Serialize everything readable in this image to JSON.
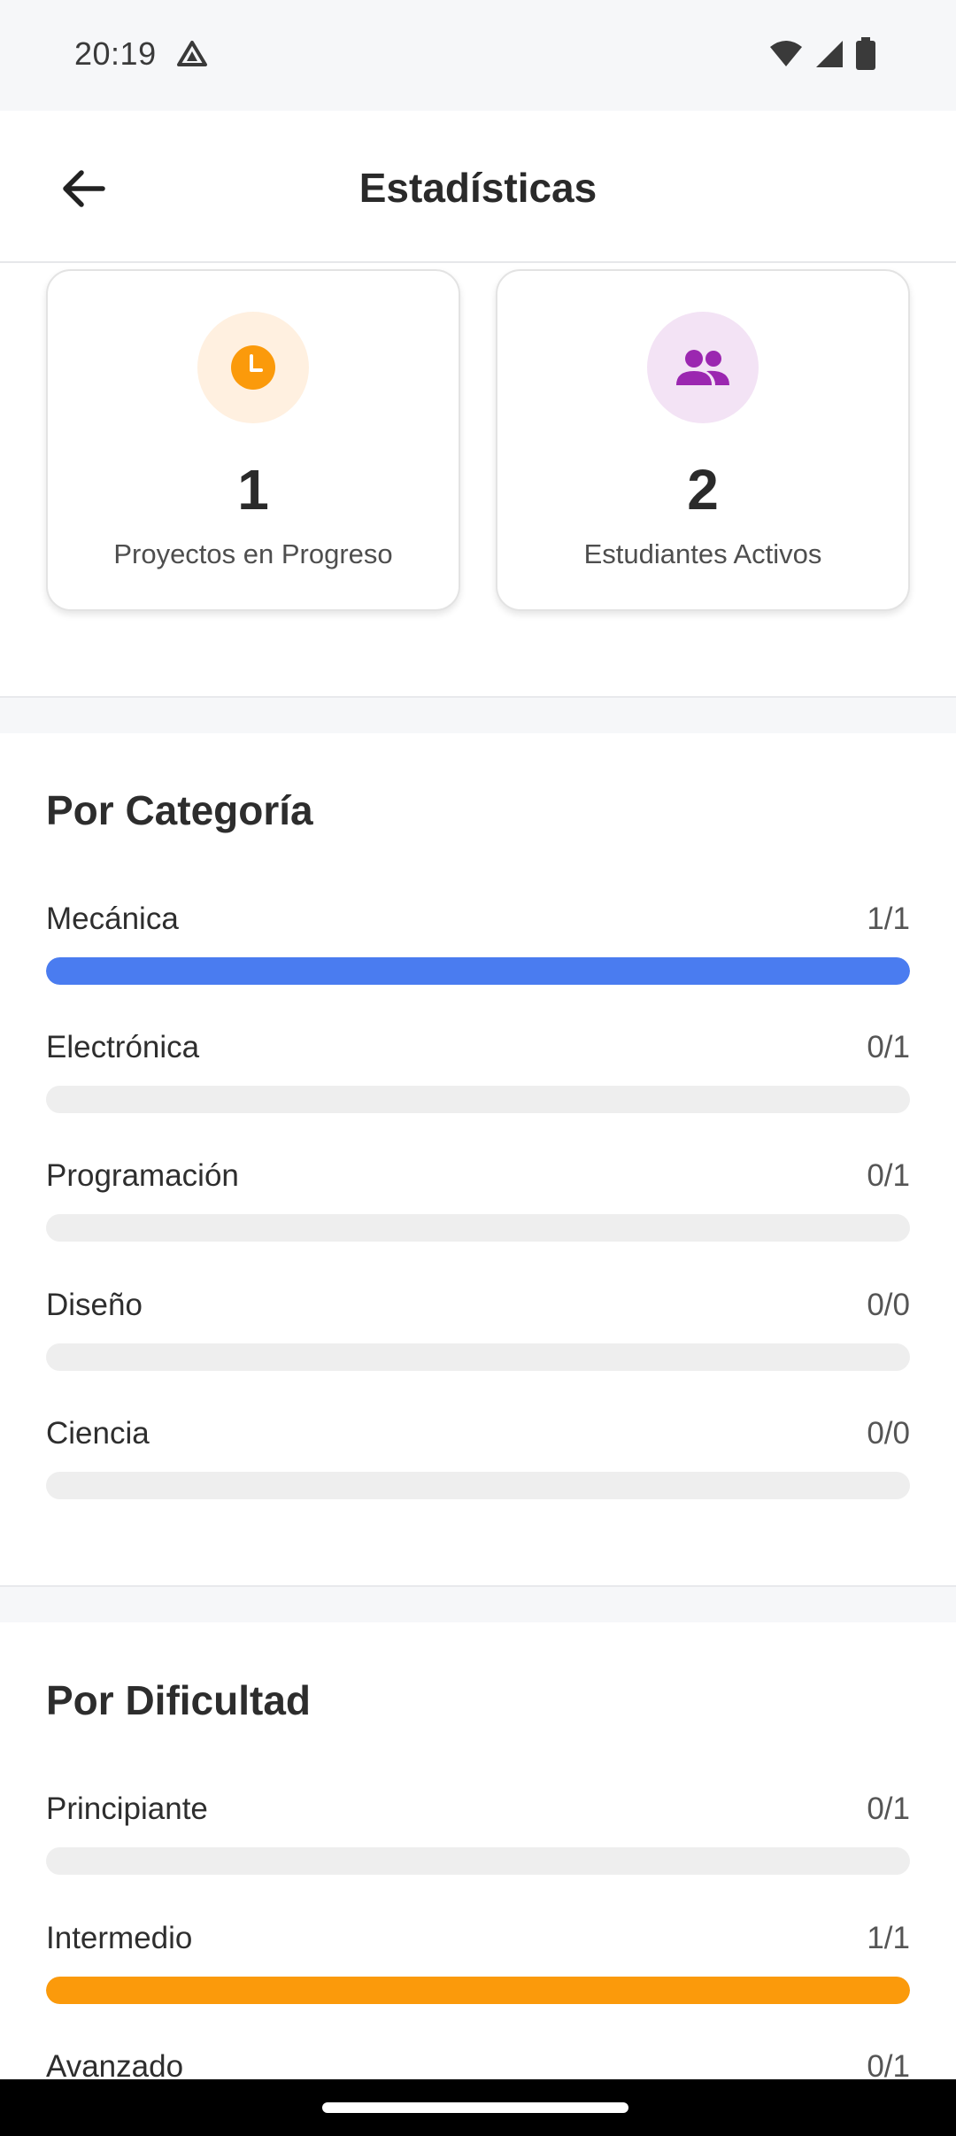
{
  "status_bar": {
    "time": "20:19"
  },
  "app_bar": {
    "title": "Estadísticas"
  },
  "cards": [
    {
      "value": "1",
      "label": "Proyectos en Progreso",
      "icon": "clock-icon",
      "icon_color": "#fb9a0b",
      "bg_color": "#fff0e0"
    },
    {
      "value": "2",
      "label": "Estudiantes Activos",
      "icon": "group-icon",
      "icon_color": "#9b27b0",
      "bg_color": "#f3e3f5"
    }
  ],
  "category_section": {
    "title": "Por Categoría",
    "items": [
      {
        "label": "Mecánica",
        "count": "1/1",
        "progress": 1.0,
        "color": "#4a7cf0"
      },
      {
        "label": "Electrónica",
        "count": "0/1",
        "progress": 0.0,
        "color": "#4a7cf0"
      },
      {
        "label": "Programación",
        "count": "0/1",
        "progress": 0.0,
        "color": "#4a7cf0"
      },
      {
        "label": "Diseño",
        "count": "0/0",
        "progress": 0.0,
        "color": "#4a7cf0"
      },
      {
        "label": "Ciencia",
        "count": "0/0",
        "progress": 0.0,
        "color": "#4a7cf0"
      }
    ]
  },
  "difficulty_section": {
    "title": "Por Dificultad",
    "items": [
      {
        "label": "Principiante",
        "count": "0/1",
        "progress": 0.0,
        "color": "#fb9a0b"
      },
      {
        "label": "Intermedio",
        "count": "1/1",
        "progress": 1.0,
        "color": "#fb9a0b"
      },
      {
        "label": "Avanzado",
        "count": "0/1",
        "progress": 0.0,
        "color": "#fb9a0b"
      }
    ]
  }
}
